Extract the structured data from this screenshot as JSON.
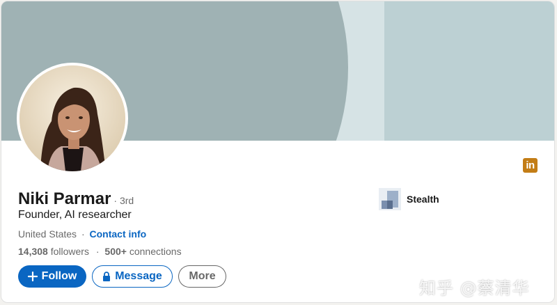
{
  "profile": {
    "name": "Niki Parmar",
    "degree": "· 3rd",
    "headline": "Founder, AI researcher",
    "location": "United States",
    "separator": "·",
    "contact_label": "Contact info",
    "followers_count": "14,308",
    "followers_label": "followers",
    "stats_separator": "·",
    "connections_count": "500+",
    "connections_label": "connections"
  },
  "actions": {
    "follow_label": "Follow",
    "message_label": "Message",
    "more_label": "More"
  },
  "company": {
    "name": "Stealth"
  },
  "badge": {
    "label": "in",
    "color": "#c37d16"
  },
  "watermark": {
    "text": "知乎 @蔡清华"
  },
  "colors": {
    "primary": "#0a66c2",
    "banner_dark": "#9fb2b4",
    "banner_light": "#bcd0d3"
  },
  "icons": {
    "follow": "plus-icon",
    "message": "lock-icon",
    "badge": "linkedin-icon",
    "company": "stealth-logo"
  }
}
